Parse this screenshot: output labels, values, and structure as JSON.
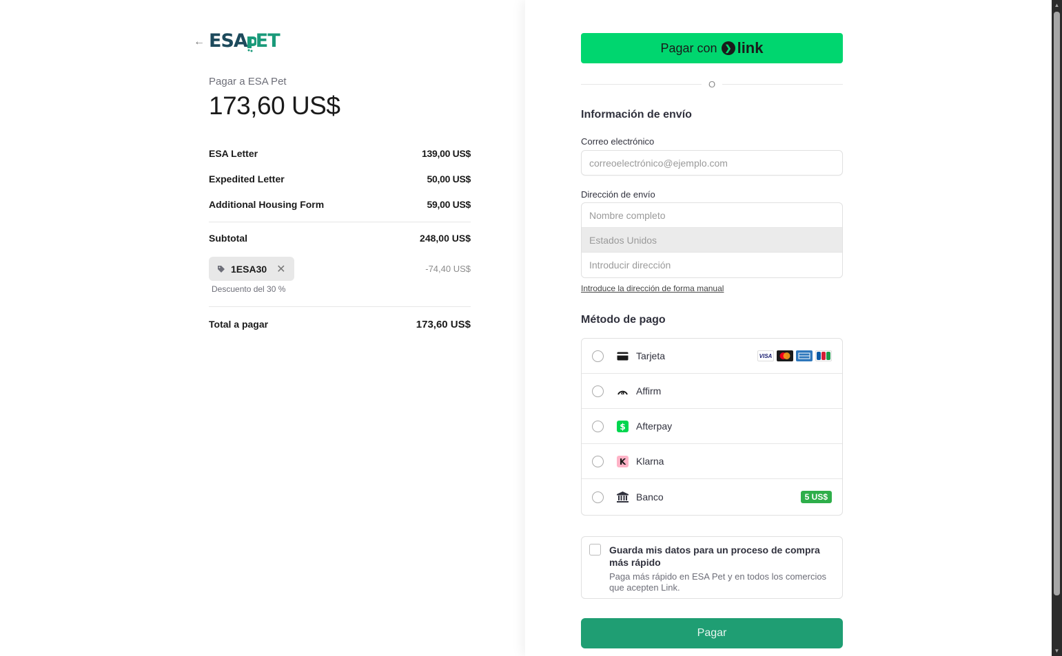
{
  "merchant": {
    "logo_text_left": "ESA",
    "logo_text_right": "ET",
    "pay_to": "Pagar a ESA Pet",
    "amount": "173,60 US$"
  },
  "line_items": [
    {
      "name": "ESA Letter",
      "price": "139,00 US$"
    },
    {
      "name": "Expedited Letter",
      "price": "50,00 US$"
    },
    {
      "name": "Additional Housing Form",
      "price": "59,00 US$"
    }
  ],
  "summary": {
    "subtotal_label": "Subtotal",
    "subtotal_value": "248,00 US$",
    "promo_code": "1ESA30",
    "promo_discount": "-74,40 US$",
    "promo_note": "Descuento del 30 %",
    "total_label": "Total a pagar",
    "total_value": "173,60 US$"
  },
  "link_button": {
    "label": "Pagar con",
    "brand": "link"
  },
  "divider_text": "O",
  "shipping": {
    "title": "Información de envío",
    "email_label": "Correo electrónico",
    "email_placeholder": "correoelectrónico@ejemplo.com",
    "address_label": "Dirección de envío",
    "name_placeholder": "Nombre completo",
    "country_value": "Estados Unidos",
    "address_placeholder": "Introducir dirección",
    "manual_link": "Introduce la dirección de forma manual"
  },
  "payment": {
    "title": "Método de pago",
    "methods": [
      {
        "label": "Tarjeta",
        "icon": "credit-card-icon"
      },
      {
        "label": "Affirm",
        "icon": "affirm-icon"
      },
      {
        "label": "Afterpay",
        "icon": "afterpay-icon"
      },
      {
        "label": "Klarna",
        "icon": "klarna-icon"
      },
      {
        "label": "Banco",
        "icon": "bank-icon",
        "badge": "5 US$"
      }
    ],
    "card_brands": [
      "VISA",
      "Mastercard",
      "AMEX",
      "JCB"
    ]
  },
  "save_info": {
    "title": "Guarda mis datos para un proceso de compra más rápido",
    "description": "Paga más rápido en ESA Pet y en todos los comercios que acepten Link."
  },
  "pay_button": "Pagar",
  "colors": {
    "link_green": "#00d66f",
    "pay_button": "#1f9e73",
    "logo_dark": "#1d4a5c",
    "logo_green": "#1a9a7a",
    "badge_green": "#2eae4a"
  }
}
